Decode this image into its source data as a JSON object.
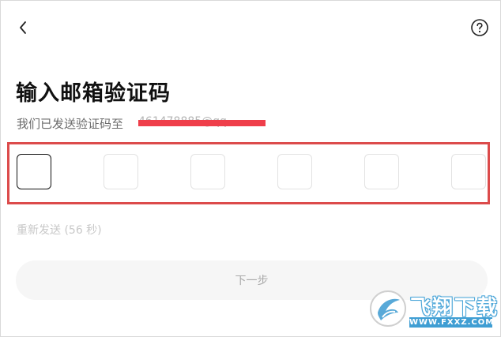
{
  "header": {
    "back_icon": "chevron-left-icon",
    "help_icon": "question-circle-icon"
  },
  "main": {
    "title": "输入邮箱验证码",
    "subtitle": "我们已发送验证码至",
    "email_partial": "461478885@qq.",
    "code_length": 6,
    "resend_text": "重新发送 (56 秒)",
    "next_button_label": "下一步"
  },
  "watermark": {
    "logo_text": "飞翔下载",
    "url": "WWW.FXXZ.COM"
  },
  "colors": {
    "highlight_border": "#dc4b4b",
    "redaction": "#ef3e4a",
    "button_bg": "#f6f6f6",
    "watermark_blue": "#3f9ed3"
  }
}
